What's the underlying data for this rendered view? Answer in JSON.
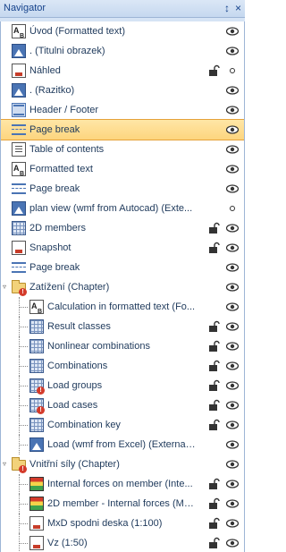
{
  "title": "Navigator",
  "title_buttons": {
    "pin": "↕",
    "close": "×"
  },
  "items": [
    {
      "label": "Úvod (Formatted text)",
      "icon": "text",
      "level": 0,
      "vis": "eye",
      "lock": false
    },
    {
      "label": ". (Titulni obrazek)",
      "icon": "image",
      "level": 0,
      "vis": "eye",
      "lock": false
    },
    {
      "label": "Náhled",
      "icon": "snapshot",
      "level": 0,
      "vis": "circle",
      "lock": true
    },
    {
      "label": ". (Razitko)",
      "icon": "image",
      "level": 0,
      "vis": "eye",
      "lock": false
    },
    {
      "label": "Header / Footer",
      "icon": "header",
      "level": 0,
      "vis": "eye",
      "lock": false
    },
    {
      "label": "Page break",
      "icon": "pagebreak",
      "level": 0,
      "vis": "eye",
      "lock": false,
      "selected": true
    },
    {
      "label": "Table of contents",
      "icon": "toc",
      "level": 0,
      "vis": "eye",
      "lock": false
    },
    {
      "label": "Formatted text",
      "icon": "text",
      "level": 0,
      "vis": "eye",
      "lock": false
    },
    {
      "label": "Page break",
      "icon": "pagebreak",
      "level": 0,
      "vis": "eye",
      "lock": false
    },
    {
      "label": "plan view (wmf from Autocad) (Exte...",
      "icon": "image",
      "level": 0,
      "vis": "circle",
      "lock": false
    },
    {
      "label": "2D members",
      "icon": "table",
      "level": 0,
      "vis": "eye",
      "lock": true
    },
    {
      "label": "Snapshot",
      "icon": "snapshot",
      "level": 0,
      "vis": "eye",
      "lock": true
    },
    {
      "label": "Page break",
      "icon": "pagebreak",
      "level": 0,
      "vis": "eye",
      "lock": false
    },
    {
      "label": "Zatížení (Chapter)",
      "icon": "folder",
      "level": 0,
      "vis": "eye",
      "lock": false,
      "expanded": true,
      "warn": true
    },
    {
      "label": "Calculation in formatted text (Fo...",
      "icon": "text",
      "level": 1,
      "vis": "eye",
      "lock": false
    },
    {
      "label": "Result classes",
      "icon": "table",
      "level": 1,
      "vis": "eye",
      "lock": true
    },
    {
      "label": "Nonlinear combinations",
      "icon": "table",
      "level": 1,
      "vis": "eye",
      "lock": true
    },
    {
      "label": "Combinations",
      "icon": "table",
      "level": 1,
      "vis": "eye",
      "lock": true
    },
    {
      "label": "Load groups",
      "icon": "table",
      "level": 1,
      "vis": "eye",
      "lock": true,
      "warn": true
    },
    {
      "label": "Load cases",
      "icon": "table",
      "level": 1,
      "vis": "eye",
      "lock": true,
      "warn": true
    },
    {
      "label": "Combination key",
      "icon": "table",
      "level": 1,
      "vis": "eye",
      "lock": true
    },
    {
      "label": "Load (wmf from Excel) (External ...",
      "icon": "image",
      "level": 1,
      "vis": "eye",
      "lock": false
    },
    {
      "label": "Vnitřní síly (Chapter)",
      "icon": "folder",
      "level": 0,
      "vis": "eye",
      "lock": false,
      "expanded": true,
      "warn": true
    },
    {
      "label": "Internal forces on member (Inte...",
      "icon": "colormap",
      "level": 1,
      "vis": "eye",
      "lock": true
    },
    {
      "label": "2D member - Internal forces (Me...",
      "icon": "colormap",
      "level": 1,
      "vis": "eye",
      "lock": true
    },
    {
      "label": "MxD spodni deska (1:100)",
      "icon": "snapshot",
      "level": 1,
      "vis": "eye",
      "lock": true
    },
    {
      "label": "Vz (1:50)",
      "icon": "snapshot",
      "level": 1,
      "vis": "eye",
      "lock": true
    }
  ]
}
